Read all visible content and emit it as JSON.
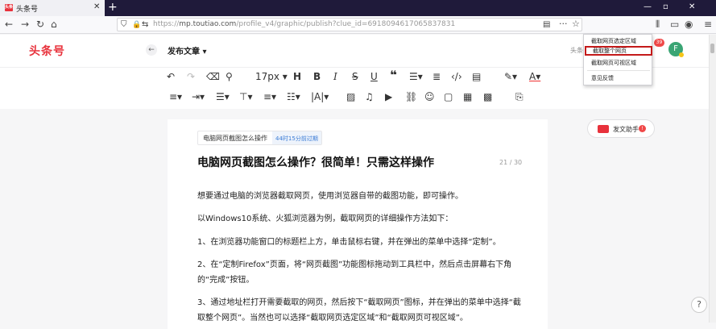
{
  "browser": {
    "tab_title": "头条号",
    "tab_favicon": "头条",
    "url_protocol": "https://",
    "url_host": "mp.toutiao.com",
    "url_path": "/profile_v4/graphic/publish?clue_id=6918094617065837831"
  },
  "header": {
    "logo": "头条号",
    "page_title": "发布文章 ▾",
    "right_text": "头条",
    "avatar_letter": "F",
    "notif_count": "39"
  },
  "toolbar": {
    "font_size": "17px ▾"
  },
  "context_menu": {
    "items": [
      "截取网页选定区域",
      "截取整个网页",
      "截取网页可视区域",
      "意见反馈"
    ]
  },
  "article": {
    "tag_text": "电脑网页截图怎么操作",
    "tag_time": "44时15分前过期",
    "title": "电脑网页截图怎么操作？很简单！只需这样操作",
    "counter": "21 / 30",
    "paragraphs": [
      "想要通过电脑的浏览器截取网页，使用浏览器自带的截图功能，即可操作。",
      "以Windows10系统、火狐浏览器为例，截取网页的详细操作方法如下：",
      "1、在浏览器功能窗口的标题栏上方，单击鼠标右键，并在弹出的菜单中选择“定制”。",
      "2、在“定制Firefox”页面，将“网页截图”功能图标拖动到工具栏中，然后点击屏幕右下角的“完成”按钮。",
      "3、通过地址栏打开需要截取的网页，然后按下“截取网页”图标，并在弹出的菜单中选择“截取整个网页”。当然也可以选择“截取网页选定区域”和“截取网页可视区域”。"
    ]
  },
  "assistant": {
    "label": "发文助手",
    "badge": "!"
  },
  "help": "?"
}
